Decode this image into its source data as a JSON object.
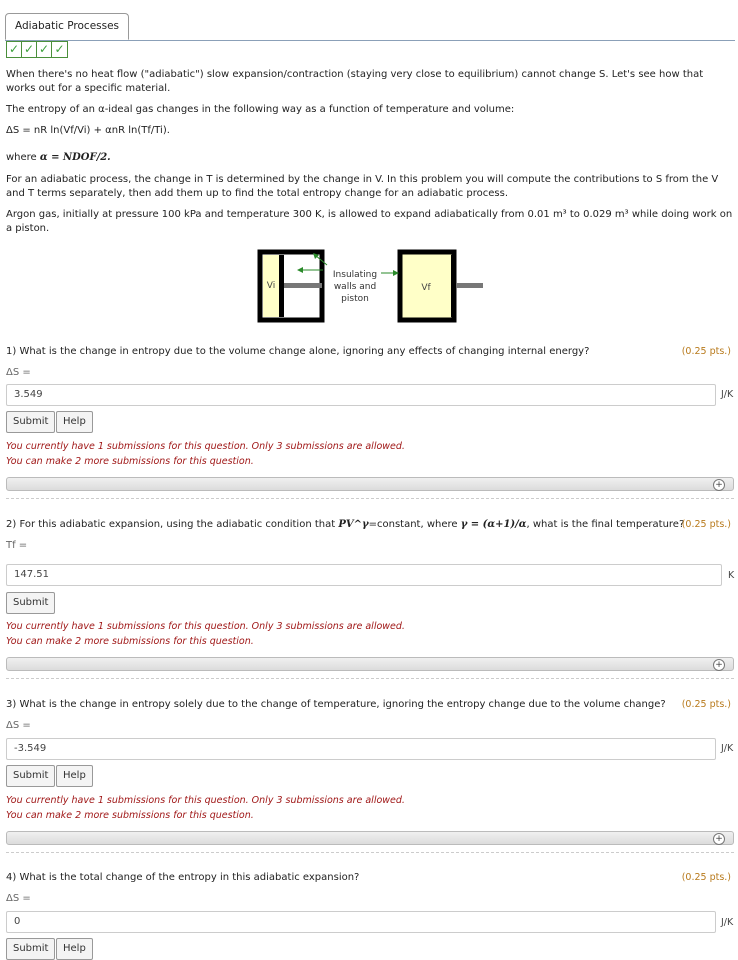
{
  "tab": {
    "title": "Adiabatic Processes"
  },
  "checks": [
    "✓",
    "✓",
    "✓",
    "✓"
  ],
  "intro": {
    "p1": "When there's no heat flow (\"adiabatic\") slow expansion/contraction (staying very close to equilibrium) cannot change S. Let's see how that works out for a specific material.",
    "p2": "The entropy of an α-ideal gas changes in the following way as a function of temperature and volume:",
    "formula": "ΔS = nR ln(Vf/Vi) + αnR ln(Tf/Ti).",
    "where_prefix": "where",
    "alpha_def": "α = NDOF/2.",
    "p3": "For an adiabatic process, the change in T is determined by the change in V. In this problem you will compute the contributions to S from the V and T terms separately, then add them up to find the total entropy change for an adiabatic process.",
    "p4": "Argon gas, initially at pressure 100 kPa and temperature 300 K, is allowed to expand adiabatically from 0.01 m³ to 0.029 m³ while doing work on a piston."
  },
  "diagram": {
    "vi": "Vi",
    "vf": "Vf",
    "caption_1": "Insulating",
    "caption_2": "walls and",
    "caption_3": "piston"
  },
  "q1": {
    "text": "1) What is the change in entropy due to the volume change alone, ignoring any effects of changing internal energy?",
    "pts": "(0.25 pts.)",
    "label": "ΔS =",
    "value": "3.549",
    "unit": "J/K",
    "submit": "Submit",
    "help": "Help",
    "msg1": "You currently have 1 submissions for this question. Only 3 submissions are allowed.",
    "msg2": "You can make 2 more submissions for this question."
  },
  "q2": {
    "text_a": "2) For this adiabatic expansion, using the adiabatic condition that",
    "pvg": "PV^γ",
    "text_b": "=constant, where",
    "gamma": "γ = (α+1)/α",
    "text_c": ", what is the final temperature?",
    "pts": "(0.25 pts.)",
    "label": "Tf =",
    "value": "147.51",
    "unit": "K",
    "submit": "Submit",
    "msg1": "You currently have 1 submissions for this question. Only 3 submissions are allowed.",
    "msg2": "You can make 2 more submissions for this question."
  },
  "q3": {
    "text": "3) What is the change in entropy solely due to the change of temperature, ignoring the entropy change due to the volume change?",
    "pts": "(0.25 pts.)",
    "label": "ΔS =",
    "value": "-3.549",
    "unit": "J/K",
    "submit": "Submit",
    "help": "Help",
    "msg1": "You currently have 1 submissions for this question. Only 3 submissions are allowed.",
    "msg2": "You can make 2 more submissions for this question."
  },
  "q4": {
    "text": "4) What is the total change of the entropy in this adiabatic expansion?",
    "pts": "(0.25 pts.)",
    "label": "ΔS =",
    "value": "0",
    "unit": "J/K",
    "submit": "Submit",
    "help": "Help"
  }
}
